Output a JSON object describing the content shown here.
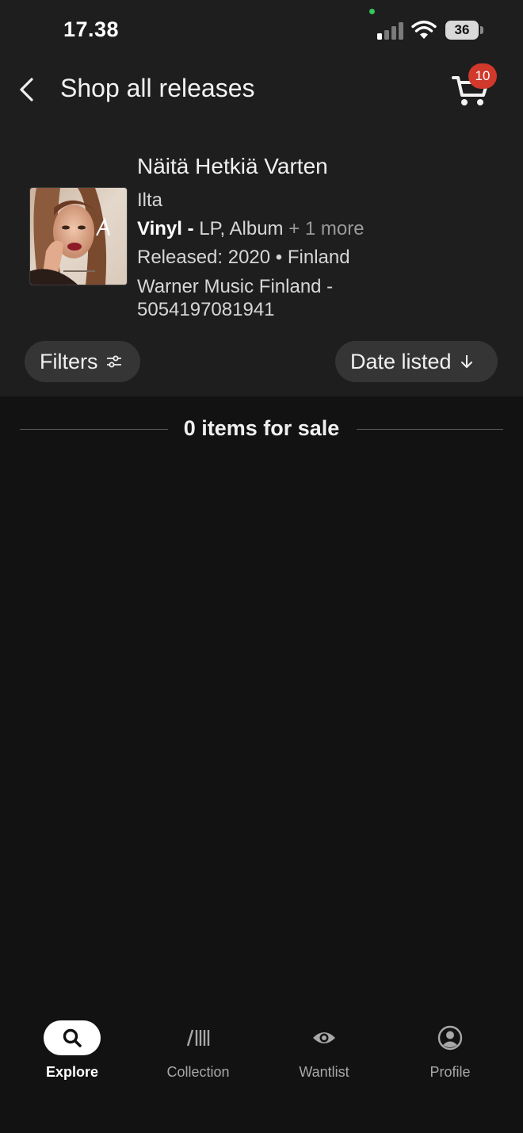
{
  "status_bar": {
    "time": "17.38",
    "battery": "36",
    "dot_color": "#35c759"
  },
  "header": {
    "title": "Shop all releases",
    "back_icon": "chevron-left-icon",
    "cart_icon": "shopping-cart-icon",
    "cart_count": "10",
    "badge_color": "#d0392b"
  },
  "release": {
    "title": "Näitä Hetkiä Varten",
    "artist": "Ilta",
    "format_type": "Vinyl -",
    "format_detail": " LP, Album",
    "format_more": " + 1 more",
    "released": "Released: 2020 • Finland",
    "label_line": "Warner Music Finland - 5054197081941"
  },
  "controls": {
    "filters_label": "Filters",
    "filters_icon": "sliders-icon",
    "sort_label": "Date listed",
    "sort_icon": "arrow-down-icon"
  },
  "listing": {
    "count_label": "0 items for sale"
  },
  "bottom_nav": {
    "items": [
      {
        "label": "Explore",
        "icon": "search-icon",
        "active": true
      },
      {
        "label": "Collection",
        "icon": "collection-icon",
        "active": false
      },
      {
        "label": "Wantlist",
        "icon": "eye-icon",
        "active": false
      },
      {
        "label": "Profile",
        "icon": "profile-icon",
        "active": false
      }
    ]
  }
}
